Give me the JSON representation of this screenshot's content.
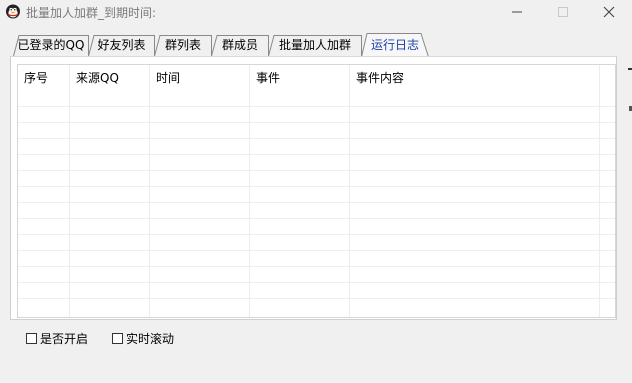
{
  "window": {
    "title": "批量加人加群_到期时间:",
    "colors": {
      "background": "#f0f0f0",
      "accent_tab_text": "#1a3fa8"
    }
  },
  "tabs": [
    {
      "label": "已登录的QQ",
      "active": false
    },
    {
      "label": "好友列表",
      "active": false
    },
    {
      "label": "群列表",
      "active": false
    },
    {
      "label": "群成员",
      "active": false
    },
    {
      "label": "批量加人加群",
      "active": false
    },
    {
      "label": "运行日志",
      "active": true
    }
  ],
  "log_table": {
    "columns": [
      "序号",
      "来源QQ",
      "时间",
      "事件",
      "事件内容"
    ],
    "rows": []
  },
  "options": {
    "enable_label": "是否开启",
    "enable_checked": false,
    "realtime_scroll_label": "实时滚动",
    "realtime_scroll_checked": false
  },
  "icons": {
    "app": "penguin-icon",
    "minimize": "minimize-icon",
    "maximize": "maximize-icon",
    "close": "close-icon"
  }
}
